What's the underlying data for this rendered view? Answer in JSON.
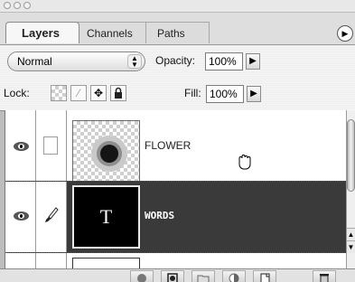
{
  "tabs": [
    "Layers",
    "Channels",
    "Paths"
  ],
  "options": {
    "blend_mode": "Normal",
    "opacity_label": "Opacity:",
    "opacity_value": "100%",
    "lock_label": "Lock:",
    "fill_label": "Fill:",
    "fill_value": "100%"
  },
  "layers": [
    {
      "name": "FLOWER",
      "visible": true,
      "selected": false
    },
    {
      "name": "WORDS",
      "visible": true,
      "selected": true,
      "thumb_text": "T"
    }
  ],
  "icons": {
    "panel_menu": "flyout-menu-icon",
    "lock_transparency": "checker-icon",
    "lock_image": "brush-icon",
    "lock_position": "move-icon",
    "lock_all": "lock-icon",
    "cursor": "hand-cursor-icon",
    "bottom": [
      "layer-style-icon",
      "mask-icon",
      "folder-icon",
      "adjustment-icon",
      "new-layer-icon",
      "trash-icon"
    ]
  },
  "colors": {
    "selected_layer_bg": "#3a3a3a",
    "panel_bg": "#bdbdbd"
  }
}
